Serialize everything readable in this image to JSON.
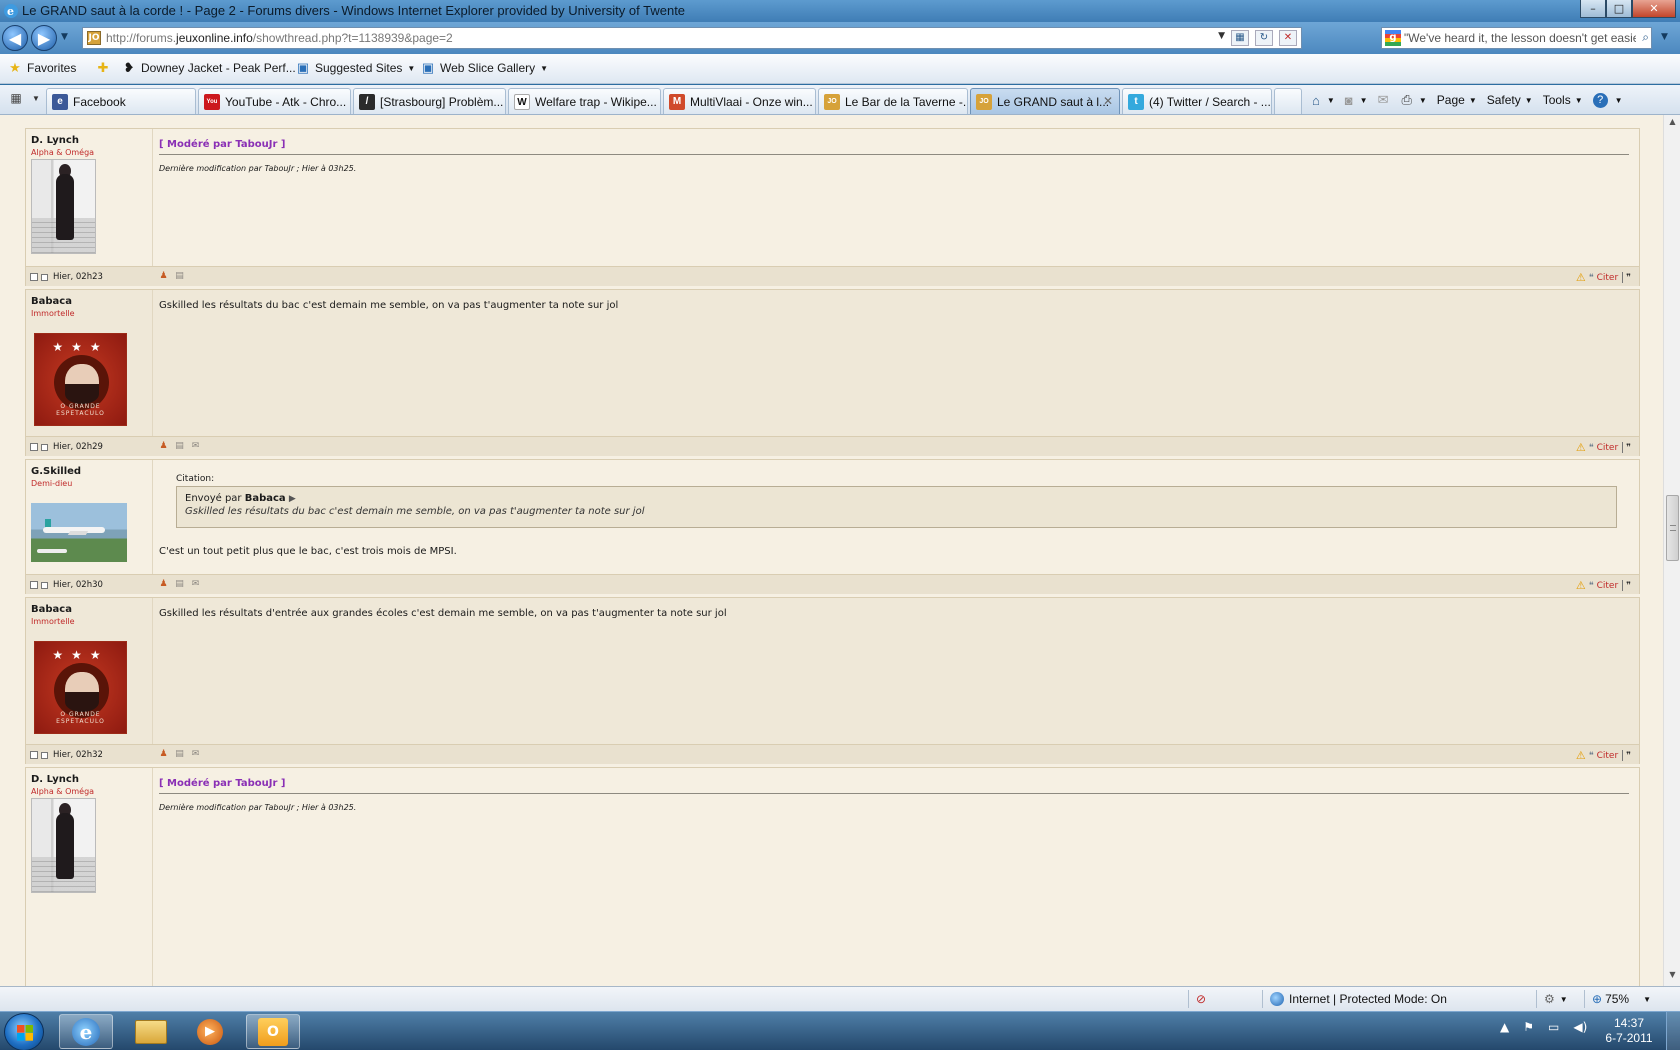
{
  "window": {
    "title": "Le GRAND saut à la corde ! - Page 2 - Forums divers - Windows Internet Explorer provided by University of Twente",
    "minimize": "–",
    "maximize": "□",
    "close": "✕"
  },
  "address_bar": {
    "url_prefix": "http://forums.",
    "url_domain": "jeuxonline.info",
    "url_path": "/showthread.php?t=1138939&page=2",
    "favicon_text": "JO"
  },
  "search_bar": {
    "value": "\"We've heard it, the lesson doesn't get easier.\""
  },
  "favorites_bar": {
    "favorites_label": "Favorites",
    "items": [
      {
        "label": "Downey Jacket - Peak Perf...",
        "icon": "footprint-icon"
      },
      {
        "label": "Suggested Sites",
        "icon": "ie-page-icon"
      },
      {
        "label": "Web Slice Gallery",
        "icon": "ie-page-icon"
      }
    ]
  },
  "tabs": [
    {
      "label": "Facebook",
      "icon_color": "#3b5998",
      "icon_text": "e",
      "active": false
    },
    {
      "label": "YouTube - Atk - Chro...",
      "icon_color": "#cc181e",
      "icon_text": "You",
      "active": false
    },
    {
      "label": "[Strasbourg] Problèm...",
      "icon_color": "#2b2b2b",
      "icon_text": "/",
      "active": false
    },
    {
      "label": "Welfare trap - Wikipe...",
      "icon_color": "#ffffff",
      "icon_text": "W",
      "active": false
    },
    {
      "label": "MultiVlaai - Onze win...",
      "icon_color": "#d04a2b",
      "icon_text": "M",
      "active": false
    },
    {
      "label": "Le Bar de la Taverne -...",
      "icon_color": "#d6a23a",
      "icon_text": "JO",
      "active": false
    },
    {
      "label": "Le GRAND saut à l...",
      "icon_color": "#d6a23a",
      "icon_text": "JO",
      "active": true
    },
    {
      "label": "(4) Twitter / Search - ...",
      "icon_color": "#33a9dd",
      "icon_text": "t",
      "active": false
    }
  ],
  "command_bar": {
    "page": "Page",
    "safety": "Safety",
    "tools": "Tools"
  },
  "posts": [
    {
      "username": "D. Lynch",
      "usertitle": "Alpha & Oméga",
      "avatar": "lynch",
      "moderated": "[ Modéré par TabouJr ]",
      "note": "Dernière modification par TabouJr ; Hier à 03h25.",
      "date": "Hier, 02h23",
      "cite": "Citer"
    },
    {
      "username": "Babaca",
      "usertitle": "Immortelle",
      "avatar": "babaca",
      "message": "Gskilled les résultats du bac c'est demain me semble, on va pas t'augmenter ta note sur jol",
      "date": "Hier, 02h29",
      "cite": "Citer"
    },
    {
      "username": "G.Skilled",
      "usertitle": "Demi-dieu",
      "avatar": "plane",
      "quote_label": "Citation:",
      "quote_by_prefix": "Envoyé par",
      "quote_author": "Babaca",
      "quote_text": "Gskilled les résultats du bac c'est demain me semble, on va pas t'augmenter ta note sur jol",
      "message": "C'est un tout petit plus que le bac, c'est trois mois de MPSI.",
      "date": "Hier, 02h30",
      "cite": "Citer"
    },
    {
      "username": "Babaca",
      "usertitle": "Immortelle",
      "avatar": "babaca",
      "message": "Gskilled les résultats d'entrée aux grandes écoles c'est demain me semble, on va pas t'augmenter ta note sur jol",
      "date": "Hier, 02h32",
      "cite": "Citer"
    },
    {
      "username": "D. Lynch",
      "usertitle": "Alpha & Oméga",
      "avatar": "lynch",
      "moderated": "[ Modéré par TabouJr ]",
      "note": "Dernière modification par TabouJr ; Hier à 03h25."
    }
  ],
  "avatar_caption": "O GRANDE ESPETACULO",
  "status_bar": {
    "zone": "Internet | Protected Mode: On",
    "zoom": "75%"
  },
  "taskbar": {
    "time": "14:37",
    "date": "6-7-2011"
  }
}
